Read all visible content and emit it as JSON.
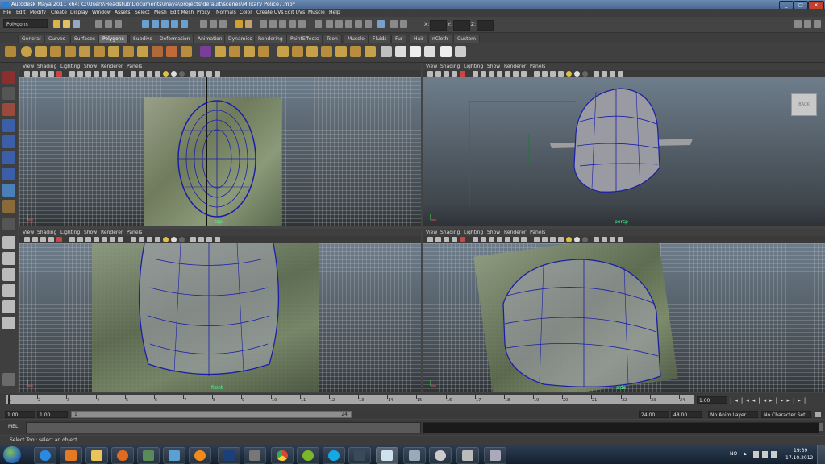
{
  "window": {
    "title": "Autodesk Maya 2011 x64: C:\\Users\\Headstub\\Documents\\maya\\projects\\default\\scenes\\Military Police7.mb*",
    "controls": [
      "_",
      "□",
      "✕"
    ]
  },
  "menubar": [
    "File",
    "Edit",
    "Modify",
    "Create",
    "Display",
    "Window",
    "Assets",
    "Select",
    "Mesh",
    "Edit Mesh",
    "Proxy",
    "Normals",
    "Color",
    "Create UVs",
    "Edit UVs",
    "Muscle",
    "Help"
  ],
  "statusline": {
    "mode": "Polygons",
    "x_label": "X:",
    "y_label": "Y:",
    "z_label": "Z:"
  },
  "shelf_tabs": [
    "General",
    "Curves",
    "Surfaces",
    "Polygons",
    "Subdivs",
    "Deformation",
    "Animation",
    "Dynamics",
    "Rendering",
    "PaintEffects",
    "Toon",
    "Muscle",
    "Fluids",
    "Fur",
    "Hair",
    "nCloth",
    "Custom"
  ],
  "active_shelf": "Polygons",
  "panel_menu": [
    "View",
    "Shading",
    "Lighting",
    "Show",
    "Renderer",
    "Panels"
  ],
  "panels": [
    {
      "id": "top",
      "camera": "top"
    },
    {
      "id": "persp",
      "camera": "persp",
      "viewcube": "BACK"
    },
    {
      "id": "front",
      "camera": "front"
    },
    {
      "id": "side",
      "camera": "side"
    }
  ],
  "timeline": {
    "ticks": [
      "1",
      "2",
      "3",
      "4",
      "5",
      "6",
      "7",
      "8",
      "9",
      "10",
      "11",
      "12",
      "13",
      "14",
      "15",
      "16",
      "17",
      "18",
      "19",
      "20",
      "21",
      "22",
      "23",
      "24"
    ],
    "current_frame": "1.00"
  },
  "range": {
    "start": "1.00",
    "start_inner": "1.00",
    "range_start": "1",
    "range_end": "24",
    "end_inner": "24.00",
    "end": "48.00",
    "anim_layer": "No Anim Layer",
    "character_set": "No Character Set"
  },
  "cmdline": {
    "label": "MEL"
  },
  "helpline": {
    "text": "Select Tool: select an object"
  },
  "taskbar": {
    "lang": "NO",
    "time": "19:39",
    "date": "17.10.2012"
  },
  "colors": {
    "title_bar": "#5a7aa2",
    "ui_bg": "#444444",
    "wire": "#1b1fa8",
    "selected_tool": "#8b2e2e"
  }
}
